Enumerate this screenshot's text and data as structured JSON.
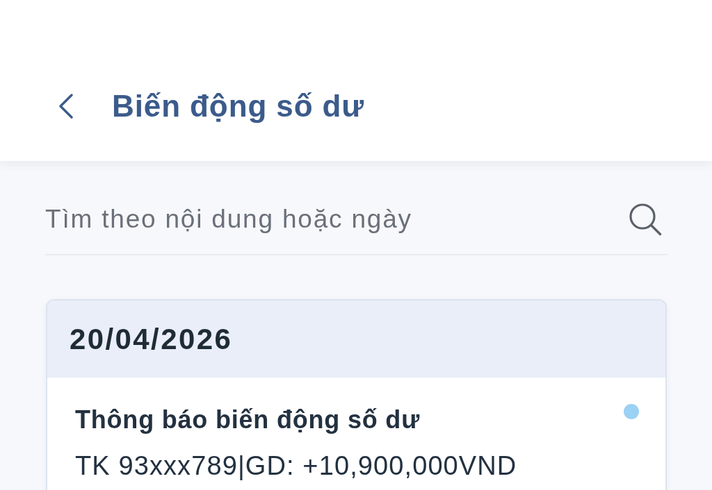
{
  "header": {
    "title": "Biến động số dư"
  },
  "search": {
    "placeholder": "Tìm theo nội dung hoặc ngày"
  },
  "groups": [
    {
      "date": "20/04/2026",
      "notifications": [
        {
          "title": "Thông báo biến động số dư",
          "unread": true,
          "text": "TK 93xxx789|GD: +10,900,000VND"
        }
      ]
    }
  ]
}
